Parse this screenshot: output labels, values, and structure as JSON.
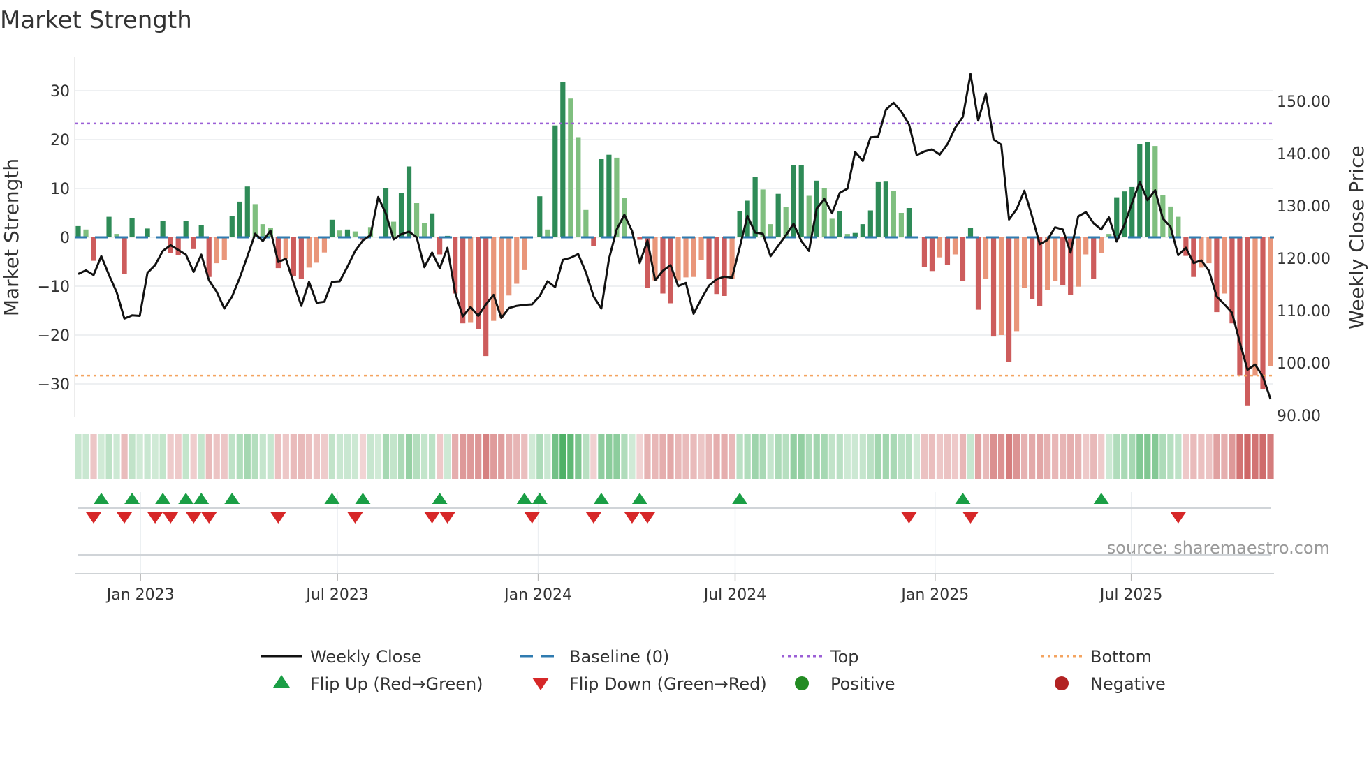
{
  "chart_data": {
    "type": "bar",
    "title": "Market Strength",
    "ylabel": "Market Strength",
    "y2label": "Weekly Close Price",
    "ylim": [
      -37,
      37
    ],
    "y2lim": [
      90,
      156
    ],
    "yticks": [
      "30",
      "20",
      "10",
      "0",
      "−10",
      "−20",
      "−30"
    ],
    "ytick_values": [
      30,
      20,
      10,
      0,
      -10,
      -20,
      -30
    ],
    "y2ticks": [
      "150.00",
      "140.00",
      "130.00",
      "120.00",
      "110.00",
      "100.00",
      "90.00"
    ],
    "y2tick_values": [
      150,
      140,
      130,
      120,
      110,
      100,
      90
    ],
    "xticks": [
      "Jan 2023",
      "Jul 2023",
      "Jan 2024",
      "Jul 2024",
      "Jan 2025",
      "Jul 2025"
    ],
    "xtick_week_index": [
      8.1,
      33.7,
      59.8,
      85.4,
      111.4,
      136.9
    ],
    "top_level": 23.3,
    "bottom_level": -28.3,
    "baseline": 0,
    "strength": [
      2.3,
      1.6,
      -4.8,
      0,
      4.2,
      0.7,
      -7.5,
      4.0,
      0,
      1.8,
      0,
      3.3,
      -3.2,
      -3.7,
      3.4,
      -2.4,
      2.5,
      -8.1,
      -5.3,
      -4.6,
      4.4,
      7.3,
      10.4,
      6.8,
      2.7,
      2.0,
      -6.3,
      -4.4,
      -7.9,
      -8.5,
      -6.2,
      -5.2,
      -3.1,
      3.6,
      1.4,
      1.6,
      1.2,
      -0.5,
      2.1,
      0,
      10.0,
      3.2,
      9.0,
      14.5,
      7.0,
      3.0,
      4.9,
      -3.5,
      0.3,
      -11.5,
      -17.6,
      -17.5,
      -18.8,
      -24.3,
      -17.1,
      -16.4,
      -11.9,
      -9.5,
      -6.7,
      0,
      8.4,
      1.6,
      22.9,
      31.8,
      28.4,
      20.5,
      5.6,
      -1.8,
      16.0,
      16.9,
      16.3,
      8.0,
      0,
      -0.5,
      -10.3,
      -8.8,
      -11.5,
      -13.5,
      -8.8,
      -8.2,
      -8.1,
      -4.6,
      -8.5,
      -11.6,
      -12.0,
      -8.5,
      5.3,
      7.5,
      12.4,
      9.8,
      2.7,
      8.9,
      6.2,
      14.8,
      14.8,
      8.5,
      11.6,
      10.1,
      3.8,
      5.3,
      0.7,
      0.9,
      2.7,
      5.5,
      11.3,
      11.4,
      9.5,
      5.0,
      6.0,
      0,
      -6.1,
      -6.9,
      -4.1,
      -5.7,
      -3.5,
      -9.0,
      1.9,
      -14.8,
      -8.5,
      -20.3,
      -20.0,
      -25.5,
      -19.2,
      -10.4,
      -12.6,
      -14.1,
      -10.8,
      -9.0,
      -9.8,
      -11.8,
      -10.1,
      -3.5,
      -8.5,
      -3.2,
      0.7,
      8.2,
      9.4,
      10.3,
      19.0,
      19.5,
      18.7,
      8.7,
      6.3,
      4.2,
      -3.8,
      -8.1,
      -6.2,
      -5.3,
      -15.3,
      -11.5,
      -17.6,
      -28.2,
      -34.4,
      -28.2,
      -31.1,
      -26.3
    ],
    "shade": "DLRDDLRDDDDDRRDRDRLLDDDLLLRLRRLLLDLDLRLDDLDDLLDRDRRLRRLLLLLDDLDDLLLRDDLLDRRLRRLLLLRRRLDDDLLDLDDLDLLDLDDDDDLLDDRRLRLRDRLRLRLLRRLLRRLLRLLDDDDDLLLLRRLLRLRRRLRL",
    "weekly_close": [
      117.0,
      117.7,
      116.8,
      120.4,
      116.8,
      113.5,
      108.5,
      109.1,
      109.0,
      117.2,
      118.7,
      121.4,
      122.5,
      121.6,
      120.7,
      117.4,
      120.7,
      115.8,
      113.6,
      110.4,
      112.7,
      116.3,
      120.4,
      124.7,
      123.3,
      125.3,
      119.3,
      119.9,
      115.3,
      110.9,
      115.5,
      111.5,
      111.7,
      115.5,
      115.6,
      118.4,
      121.4,
      123.4,
      124.4,
      131.7,
      128.5,
      123.6,
      124.6,
      125.1,
      124.0,
      118.3,
      121.1,
      118.1,
      122.0,
      113.5,
      108.9,
      110.7,
      109.0,
      111.2,
      113.0,
      108.6,
      110.5,
      110.9,
      111.1,
      111.2,
      112.8,
      115.6,
      114.5,
      119.7,
      120.1,
      120.8,
      117.3,
      112.7,
      110.4,
      119.9,
      125.5,
      128.3,
      125.2,
      119.1,
      123.4,
      115.8,
      117.6,
      118.7,
      114.7,
      115.3,
      109.4,
      112.2,
      114.8,
      116.0,
      116.5,
      116.3,
      122.1,
      128.1,
      124.9,
      124.7,
      120.4,
      122.4,
      124.4,
      126.6,
      123.3,
      121.4,
      129.5,
      131.3,
      128.6,
      132.5,
      133.3,
      140.3,
      138.6,
      143.1,
      143.2,
      148.4,
      149.7,
      148.0,
      145.6,
      139.7,
      140.4,
      140.8,
      139.8,
      141.8,
      144.9,
      147.0,
      155.2,
      146.3,
      151.5,
      142.7,
      141.7,
      127.4,
      129.4,
      132.9,
      128.0,
      122.7,
      123.5,
      125.9,
      125.5,
      121.1,
      128.0,
      128.8,
      126.7,
      125.5,
      127.8,
      123.2,
      126.4,
      130.6,
      134.6,
      131.1,
      133.0,
      127.6,
      126.0,
      120.6,
      122.0,
      119.1,
      119.6,
      117.6,
      112.7,
      111.2,
      109.6,
      104.0,
      98.7,
      99.7,
      97.4,
      93.1
    ],
    "flip_up_week_index": [
      3,
      7,
      11,
      14,
      16,
      20,
      33,
      37,
      47,
      58,
      60,
      68,
      73,
      86,
      115,
      133
    ],
    "flip_down_week_index": [
      2,
      6,
      10,
      12,
      15,
      17,
      26,
      36,
      46,
      48,
      59,
      67,
      72,
      74,
      108,
      116,
      143
    ],
    "legend_placement": "bottom",
    "legend": [
      {
        "label": "Weekly Close",
        "kind": "line"
      },
      {
        "label": "Baseline (0)",
        "kind": "dash"
      },
      {
        "label": "Top",
        "kind": "dot-top"
      },
      {
        "label": "Bottom",
        "kind": "dot-bottom"
      },
      {
        "label": "Flip Up (Red→Green)",
        "kind": "tri-up"
      },
      {
        "label": "Flip Down (Green→Red)",
        "kind": "tri-down"
      },
      {
        "label": "Positive",
        "kind": "dot-pos"
      },
      {
        "label": "Negative",
        "kind": "dot-neg"
      }
    ],
    "source": "source: sharemaestro.com"
  },
  "colors": {
    "pos_strong": "#2e8b57",
    "pos_weak": "#7fbf7f",
    "neg_strong": "#cd5c5c",
    "neg_weak": "#e9967a",
    "line": "#111111",
    "baseline": "#2f7bb0",
    "top": "#9b5fd6",
    "bottom": "#f4a460",
    "flip_up": "#1a9e45",
    "flip_down": "#d62728",
    "positive": "#228b22",
    "negative": "#b22222"
  }
}
